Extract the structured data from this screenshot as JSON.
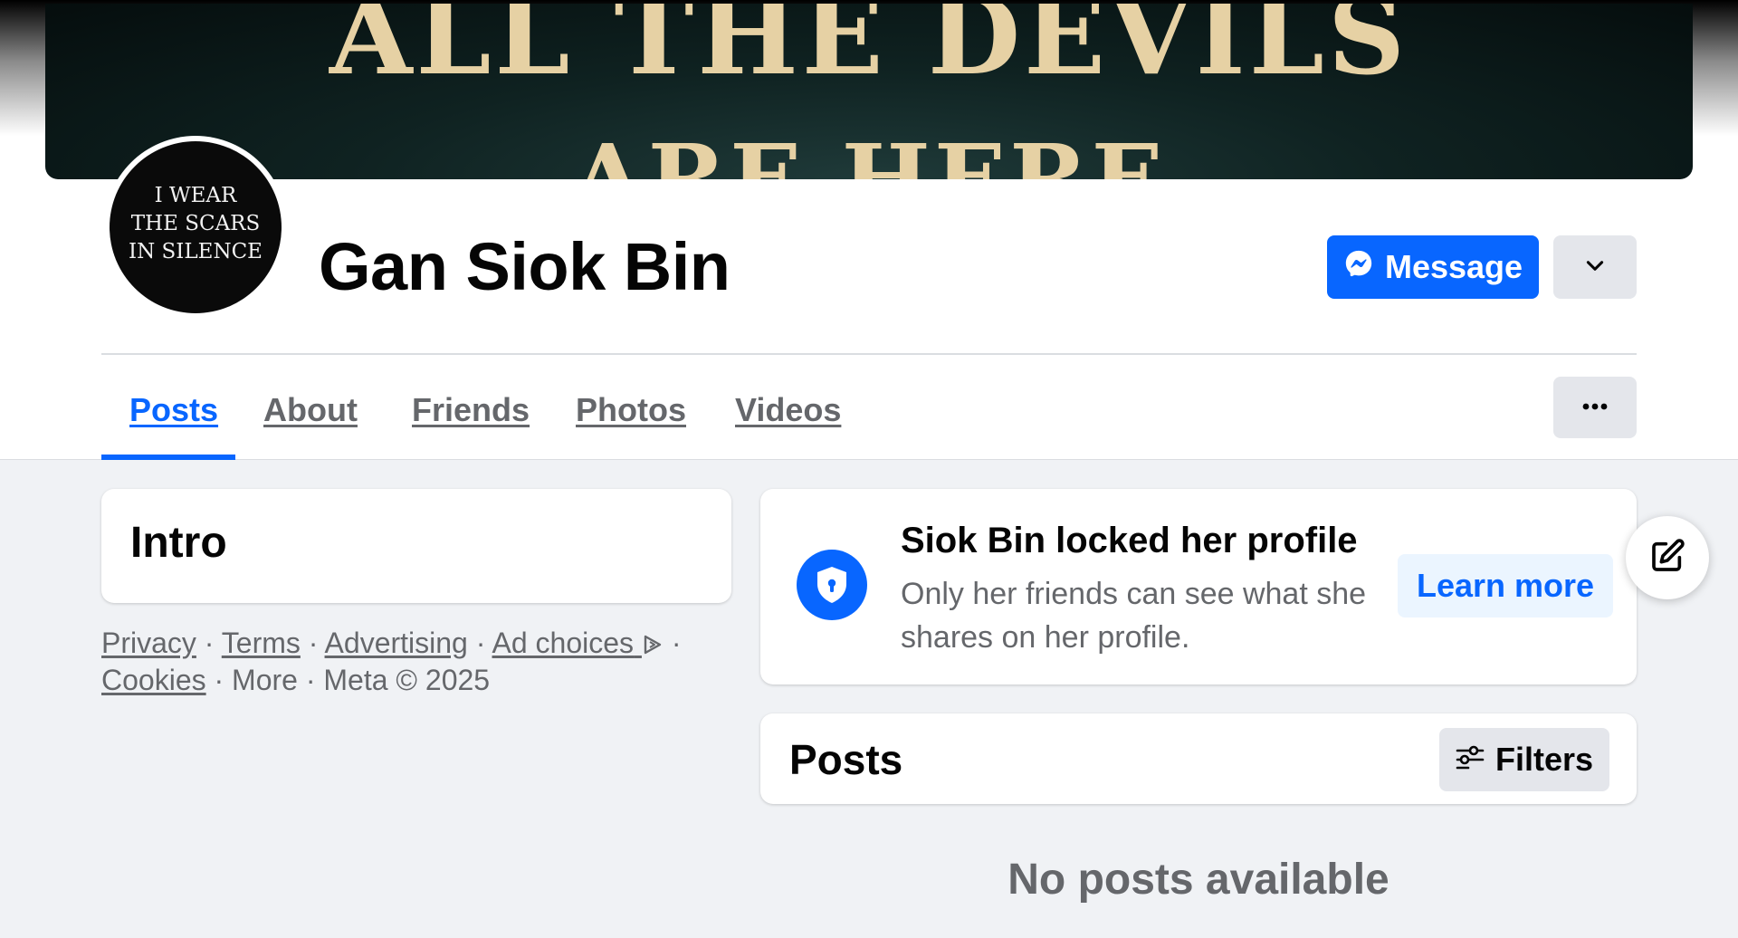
{
  "cover": {
    "line1": "ALL THE DEVILS",
    "line2": "ARE HERE"
  },
  "profile": {
    "name": "Gan Siok Bin",
    "avatar_lines": [
      "I WEAR",
      "THE SCARS",
      "IN SILENCE"
    ]
  },
  "actions": {
    "message_label": "Message",
    "message_icon": "messenger-icon",
    "dropdown_icon": "chevron-down-icon",
    "more_icon": "more-dots-icon"
  },
  "tabs": [
    {
      "label": "Posts",
      "active": true
    },
    {
      "label": "About",
      "active": false
    },
    {
      "label": "Friends",
      "active": false
    },
    {
      "label": "Photos",
      "active": false
    },
    {
      "label": "Videos",
      "active": false
    }
  ],
  "intro": {
    "title": "Intro"
  },
  "footer": {
    "privacy": "Privacy",
    "terms": "Terms",
    "advertising": "Advertising",
    "ad_choices": "Ad choices",
    "cookies": "Cookies",
    "more": "More",
    "meta": "Meta © 2025",
    "separator": "·"
  },
  "locked": {
    "title": "Siok Bin locked her profile",
    "description": "Only her friends can see what she shares on her profile.",
    "learn_more": "Learn more",
    "icon": "shield-lock-icon"
  },
  "posts": {
    "title": "Posts",
    "filters_label": "Filters",
    "filters_icon": "sliders-icon",
    "empty_text": "No posts available"
  },
  "fab": {
    "icon": "edit-icon"
  },
  "colors": {
    "accent": "#0866ff",
    "page_bg": "#f0f2f5",
    "secondary_text": "#65676b",
    "cover_text": "#e6d1a4"
  }
}
